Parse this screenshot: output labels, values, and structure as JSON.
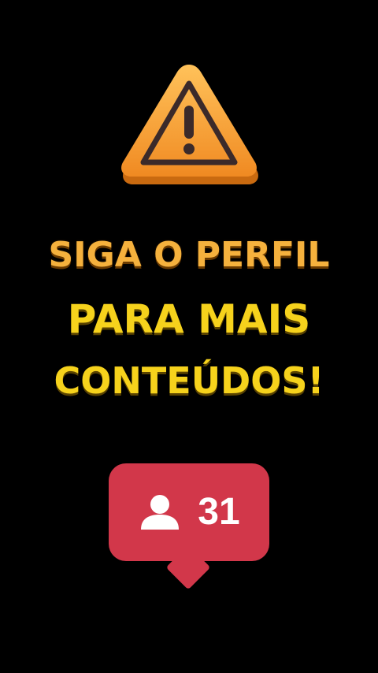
{
  "warning": {
    "icon": "warning-triangle-icon",
    "fill_color": "#f7a13a",
    "stroke_color": "#3b2a2a"
  },
  "headline": {
    "line1": "SIGA O PERFIL",
    "line2": "PARA MAIS",
    "line3": "CONTEÚDOS!"
  },
  "colors": {
    "line1": "#f5b13d",
    "line2": "#f6d21c",
    "badge": "#d2374a"
  },
  "follower_badge": {
    "icon": "person-icon",
    "count": "31"
  }
}
